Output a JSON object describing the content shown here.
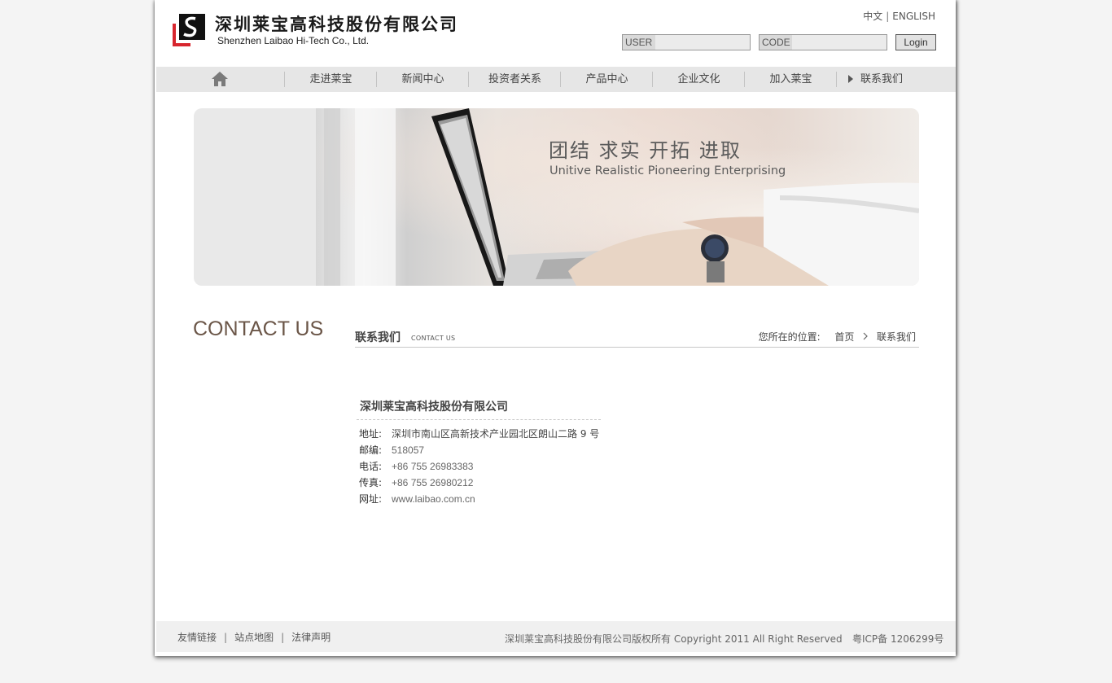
{
  "header": {
    "logo_cn": "深圳莱宝高科技股份有限公司",
    "logo_en": "Shenzhen Laibao Hi-Tech Co., Ltd.",
    "lang_cn": "中文",
    "lang_sep": "|",
    "lang_en": "ENGLISH",
    "user_placeholder": "USER",
    "code_placeholder": "CODE",
    "login_label": "Login"
  },
  "nav": {
    "items": [
      {
        "label": "走进莱宝"
      },
      {
        "label": "新闻中心"
      },
      {
        "label": "投资者关系"
      },
      {
        "label": "产品中心"
      },
      {
        "label": "企业文化"
      },
      {
        "label": "加入莱宝"
      },
      {
        "label": "联系我们"
      }
    ]
  },
  "banner": {
    "title": "团结  求实  开拓  进取",
    "subtitle": "Unitive Realistic Pioneering Enterprising"
  },
  "main": {
    "side_title": "CONTACT US",
    "section_title": "联系我们",
    "section_title_en": "CONTACT US",
    "breadcrumb": {
      "prefix": "您所在的位置:",
      "home": "首页",
      "current": "联系我们"
    },
    "company_name": "深圳莱宝高科技股份有限公司",
    "contacts": [
      {
        "label": "地址:",
        "value": "深圳市南山区高新技术产业园北区朗山二路 9 号"
      },
      {
        "label": "邮编:",
        "value": "518057"
      },
      {
        "label": "电话:",
        "value": "+86 755 26983383"
      },
      {
        "label": "传真:",
        "value": "+86 755 26980212"
      },
      {
        "label": "网址:",
        "value": "www.laibao.com.cn"
      }
    ]
  },
  "footer": {
    "links": [
      {
        "label": "友情链接"
      },
      {
        "label": "站点地图"
      },
      {
        "label": "法律声明"
      }
    ],
    "separator": "|",
    "copyright": "深圳莱宝高科技股份有限公司版权所有 Copyright 2011 All Right Reserved",
    "icp": "粤ICP备 1206299号"
  },
  "colors": {
    "nav_bg": "#e6e6e6",
    "side_title": "#6b5648",
    "logo_red": "#d7262e"
  },
  "icons": {
    "home": "home-icon",
    "nav_arrow": "triangle-right-icon",
    "breadcrumb_chevron": "chevron-right-icon"
  }
}
